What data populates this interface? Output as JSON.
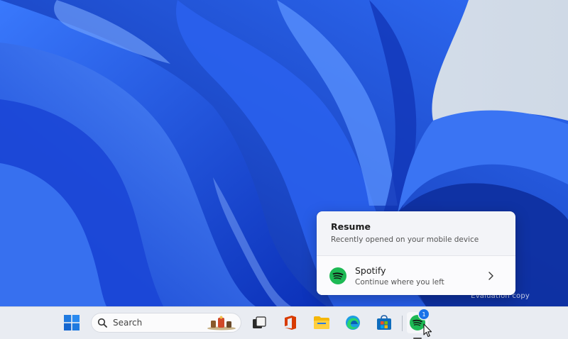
{
  "desktop": {
    "watermark": "Evaluation copy"
  },
  "resume_flyout": {
    "title": "Resume",
    "subtitle": "Recently opened on your mobile device",
    "item": {
      "app_name": "Spotify",
      "description": "Continue where you left",
      "icon": "spotify-icon"
    }
  },
  "taskbar": {
    "search_placeholder": "Search",
    "icons": [
      "windows-start-icon",
      "search-icon",
      "task-view-icon",
      "office-icon",
      "file-explorer-icon",
      "edge-icon",
      "store-icon",
      "spotify-icon"
    ],
    "spotify_badge": "1"
  },
  "colors": {
    "accent": "#1a73e8",
    "spotify_green": "#1db954",
    "wallpaper_blue": "#1d4fd8"
  }
}
